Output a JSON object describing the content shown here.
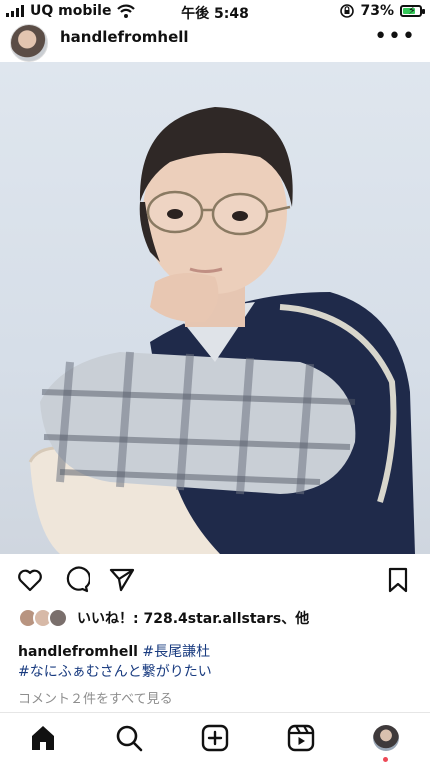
{
  "status_bar": {
    "carrier": "UQ mobile",
    "time": "午後 5:48",
    "battery_percent": "73%",
    "battery_level": 0.73
  },
  "post": {
    "username": "handlefromhell",
    "more_label": "•••",
    "likes_text": "いいね！: 728.4star.allstars、他",
    "caption_user": "handlefromhell",
    "hashtags": [
      "#長尾謙杜",
      "#なにふぁむさんと繋がりたい"
    ],
    "comments_link": "コメント２件をすべて見る"
  },
  "icons": {
    "heart": "heart-icon",
    "comment": "comment-icon",
    "share": "send-icon",
    "save": "bookmark-icon",
    "home": "home-icon",
    "search": "search-icon",
    "create": "plus-square-icon",
    "reels": "reels-icon"
  }
}
